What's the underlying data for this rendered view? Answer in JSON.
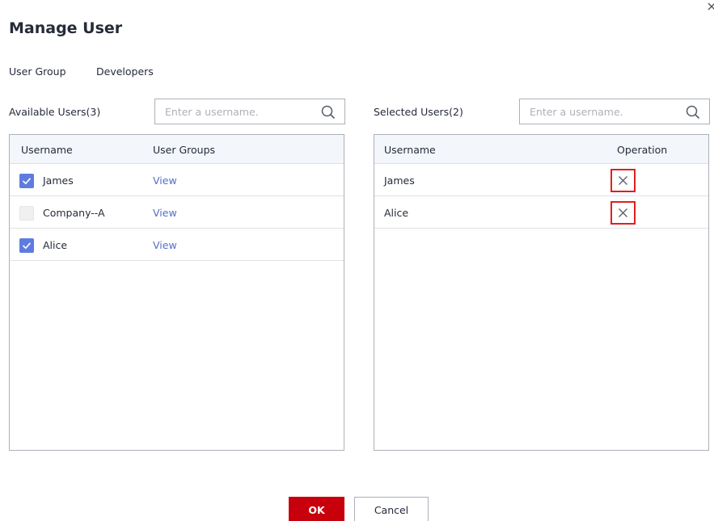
{
  "dialog": {
    "title": "Manage User",
    "close_icon": "close-icon"
  },
  "user_group": {
    "label": "User Group",
    "value": "Developers"
  },
  "available": {
    "title": "Available Users(3)",
    "search_placeholder": "Enter a username.",
    "search_icon": "search-icon",
    "columns": [
      "Username",
      "User Groups"
    ],
    "rows": [
      {
        "username": "James",
        "checked": true,
        "groups_link": "View"
      },
      {
        "username": "Company--A",
        "checked": false,
        "groups_link": "View"
      },
      {
        "username": "Alice",
        "checked": true,
        "groups_link": "View"
      }
    ]
  },
  "selected": {
    "title": "Selected Users(2)",
    "search_placeholder": "Enter a username.",
    "search_icon": "search-icon",
    "columns": [
      "Username",
      "Operation"
    ],
    "rows": [
      {
        "username": "James",
        "operation_icon": "remove-icon"
      },
      {
        "username": "Alice",
        "operation_icon": "remove-icon"
      }
    ]
  },
  "footer": {
    "ok_label": "OK",
    "cancel_label": "Cancel"
  },
  "colors": {
    "primary_button": "#c7000b",
    "checkbox_checked": "#5e7ce0",
    "link": "#526ecc",
    "highlight_box": "#e02020"
  }
}
